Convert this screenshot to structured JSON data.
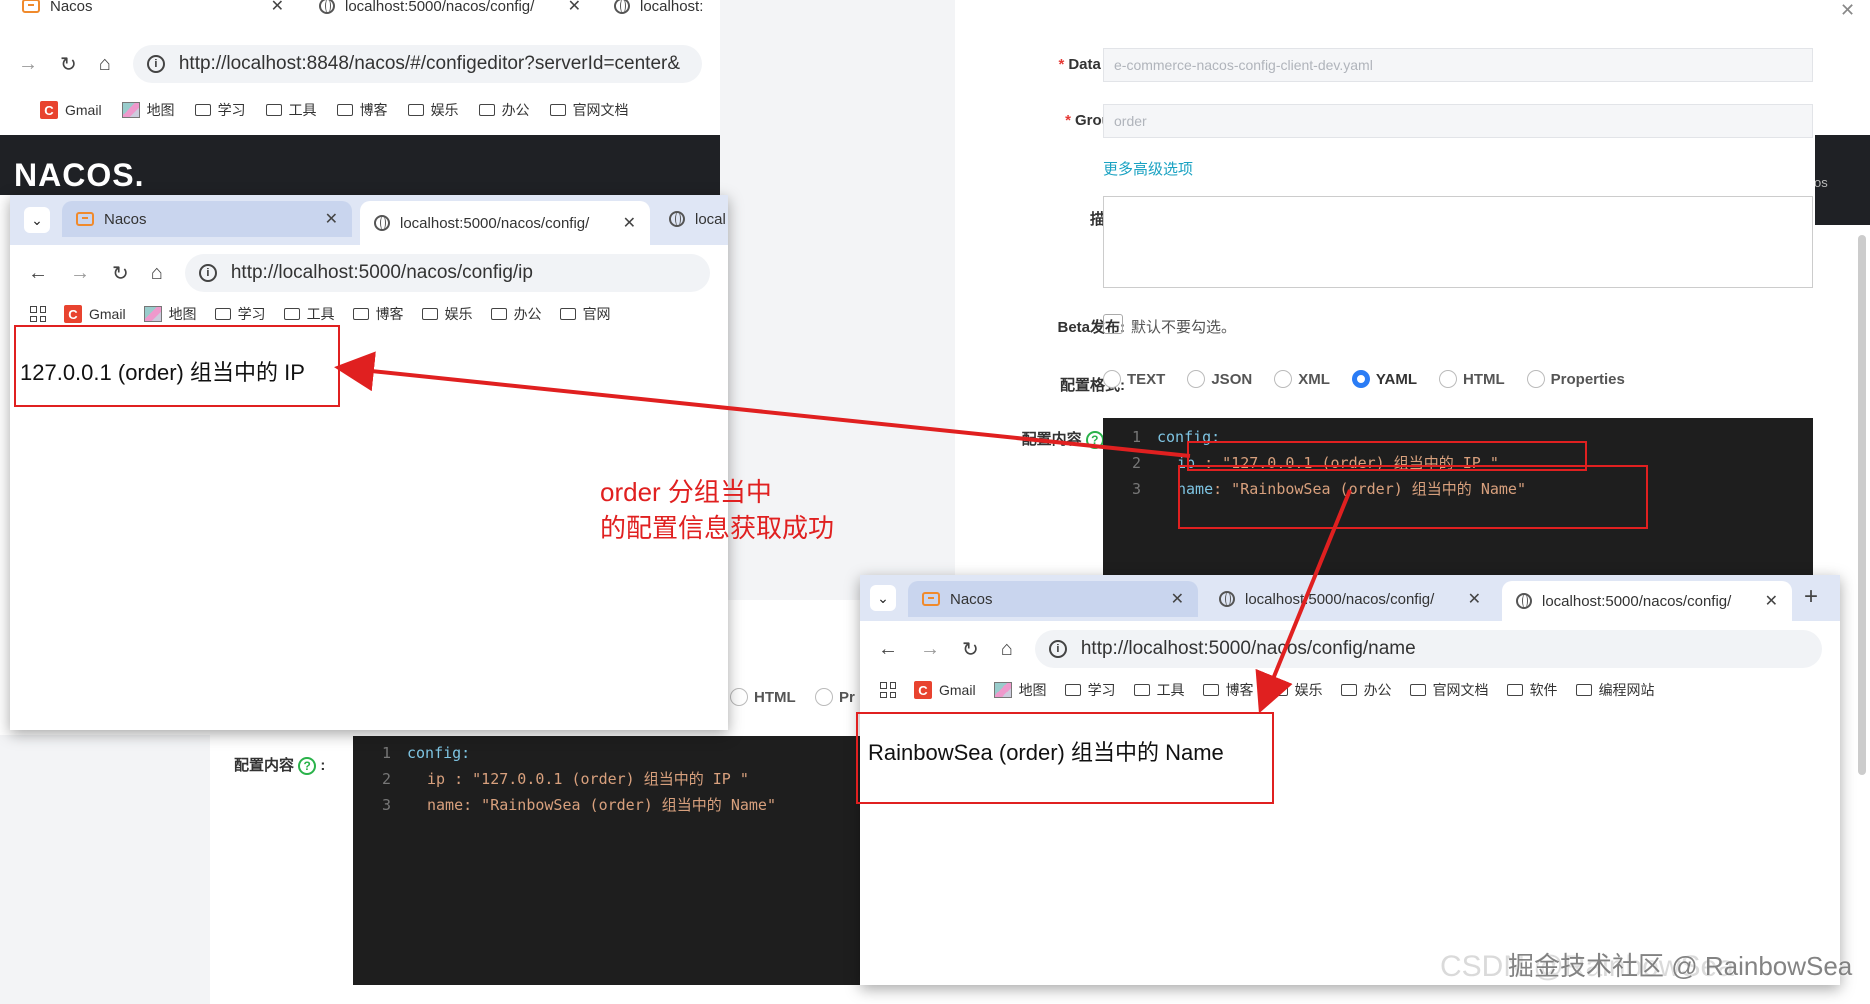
{
  "back_window": {
    "tabs": [
      {
        "title": "Nacos",
        "active": true
      },
      {
        "title": "localhost:5000/nacos/config/"
      },
      {
        "title": "localhost:"
      }
    ],
    "url": "http://localhost:8848/nacos/#/configeditor?serverId=center&",
    "bookmarks": [
      "Gmail",
      "地图",
      "学习",
      "工具",
      "博客",
      "娱乐",
      "办公",
      "官网文档"
    ],
    "logo": "NACOS.",
    "header_right": "os"
  },
  "config_form": {
    "data_id_label": "Data ID:",
    "data_id_value": "e-commerce-nacos-config-client-dev.yaml",
    "group_label": "Group:",
    "group_value": "order",
    "advanced_link": "更多高级选项",
    "desc_label": "描述:",
    "beta_label": "Beta发布:",
    "beta_hint": "默认不要勾选。",
    "format_label": "配置格式:",
    "formats": [
      "TEXT",
      "JSON",
      "XML",
      "YAML",
      "HTML",
      "Properties"
    ],
    "selected_format": "YAML",
    "content_label": "配置内容",
    "code": {
      "l1": "1",
      "l2": "2",
      "l3": "3",
      "config": "config:",
      "ip_key": "ip",
      "ip_val": " : \"127.0.0.1 (order) 组当中的 IP \"",
      "name_key": "name",
      "name_val": ": \"RainbowSea (order) 组当中的 Name\""
    }
  },
  "lower_form": {
    "format_partial": [
      "HTML",
      "Pr"
    ],
    "content_label": "配置内容",
    "code": {
      "config": "config:",
      "ip_line": "ip : \"127.0.0.1 (order) 组当中的 IP \"",
      "name_line": "name: \"RainbowSea (order) 组当中的 Name\""
    }
  },
  "ip_window": {
    "tabs": [
      {
        "title": "Nacos"
      },
      {
        "title": "localhost:5000/nacos/config/",
        "active": true
      },
      {
        "title": "local"
      }
    ],
    "url": "http://localhost:5000/nacos/config/ip",
    "bookmarks": [
      "Gmail",
      "地图",
      "学习",
      "工具",
      "博客",
      "娱乐",
      "办公",
      "官网"
    ],
    "response": "127.0.0.1 (order) 组当中的 IP"
  },
  "name_window": {
    "tabs": [
      {
        "title": "Nacos"
      },
      {
        "title": "localhost:5000/nacos/config/"
      },
      {
        "title": "localhost:5000/nacos/config/",
        "active": true
      }
    ],
    "url": "http://localhost:5000/nacos/config/name",
    "bookmarks": [
      "Gmail",
      "地图",
      "学习",
      "工具",
      "博客",
      "娱乐",
      "办公",
      "官网文档",
      "软件",
      "编程网站"
    ],
    "response": "RainbowSea (order) 组当中的 Name"
  },
  "annotation": {
    "line1": "order 分组当中",
    "line2": "的配置信息获取成功"
  },
  "watermark": "掘金技术社区 @ RainbowSea",
  "watermark_faded": "CSDN @RainbowSea",
  "colors": {
    "accent_red": "#e02020",
    "nacos_dark": "#1f2125",
    "radio_blue": "#2a7cf5",
    "link_teal": "#1aa2c2"
  }
}
